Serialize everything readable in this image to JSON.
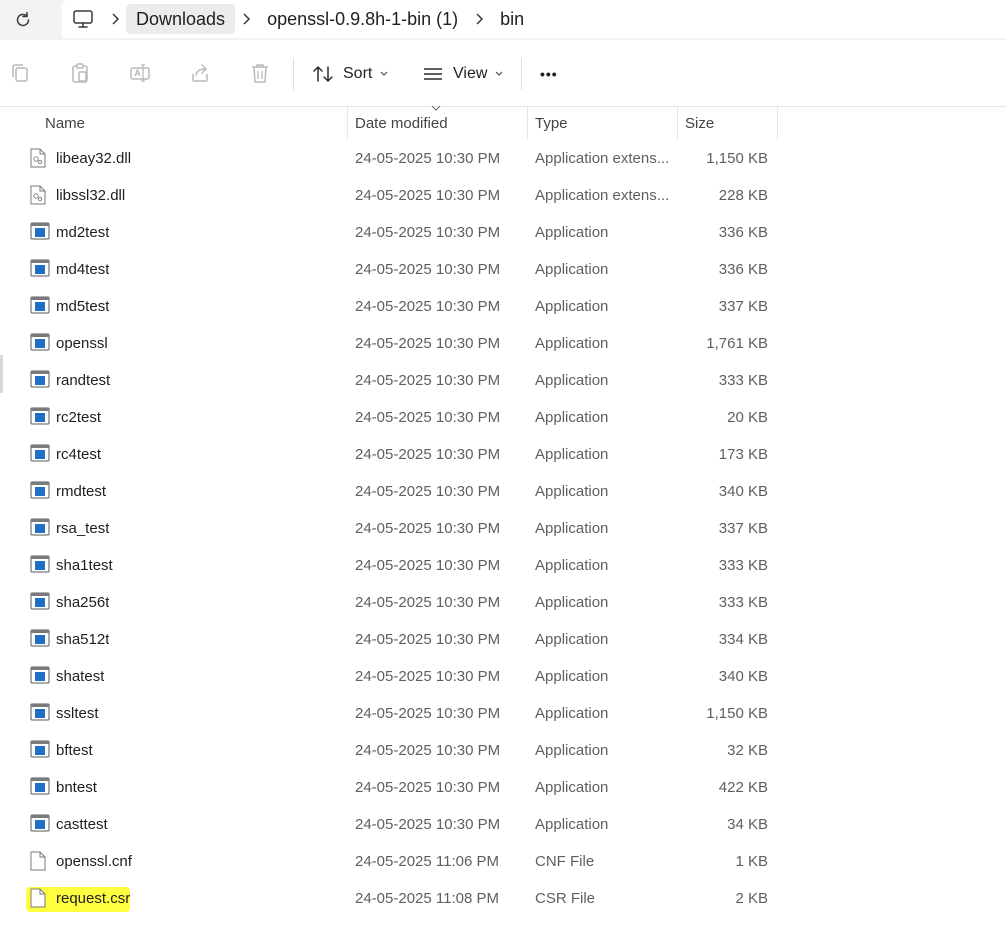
{
  "address": {
    "breadcrumbs": [
      "Downloads",
      "openssl-0.9.8h-1-bin (1)",
      "bin"
    ]
  },
  "toolbar": {
    "sort_label": "Sort",
    "view_label": "View",
    "more_label": "•••"
  },
  "columns": {
    "name": "Name",
    "date": "Date modified",
    "type": "Type",
    "size": "Size"
  },
  "files": [
    {
      "name": "libeay32.dll",
      "date": "24-05-2025 10:30 PM",
      "type": "Application extens...",
      "size": "1,150 KB",
      "icon": "dll-file-icon"
    },
    {
      "name": "libssl32.dll",
      "date": "24-05-2025 10:30 PM",
      "type": "Application extens...",
      "size": "228 KB",
      "icon": "dll-file-icon"
    },
    {
      "name": "md2test",
      "date": "24-05-2025 10:30 PM",
      "type": "Application",
      "size": "336 KB",
      "icon": "application-icon"
    },
    {
      "name": "md4test",
      "date": "24-05-2025 10:30 PM",
      "type": "Application",
      "size": "336 KB",
      "icon": "application-icon"
    },
    {
      "name": "md5test",
      "date": "24-05-2025 10:30 PM",
      "type": "Application",
      "size": "337 KB",
      "icon": "application-icon"
    },
    {
      "name": "openssl",
      "date": "24-05-2025 10:30 PM",
      "type": "Application",
      "size": "1,761 KB",
      "icon": "application-icon"
    },
    {
      "name": "randtest",
      "date": "24-05-2025 10:30 PM",
      "type": "Application",
      "size": "333 KB",
      "icon": "application-icon"
    },
    {
      "name": "rc2test",
      "date": "24-05-2025 10:30 PM",
      "type": "Application",
      "size": "20 KB",
      "icon": "application-icon"
    },
    {
      "name": "rc4test",
      "date": "24-05-2025 10:30 PM",
      "type": "Application",
      "size": "173 KB",
      "icon": "application-icon"
    },
    {
      "name": "rmdtest",
      "date": "24-05-2025 10:30 PM",
      "type": "Application",
      "size": "340 KB",
      "icon": "application-icon"
    },
    {
      "name": "rsa_test",
      "date": "24-05-2025 10:30 PM",
      "type": "Application",
      "size": "337 KB",
      "icon": "application-icon"
    },
    {
      "name": "sha1test",
      "date": "24-05-2025 10:30 PM",
      "type": "Application",
      "size": "333 KB",
      "icon": "application-icon"
    },
    {
      "name": "sha256t",
      "date": "24-05-2025 10:30 PM",
      "type": "Application",
      "size": "333 KB",
      "icon": "application-icon"
    },
    {
      "name": "sha512t",
      "date": "24-05-2025 10:30 PM",
      "type": "Application",
      "size": "334 KB",
      "icon": "application-icon"
    },
    {
      "name": "shatest",
      "date": "24-05-2025 10:30 PM",
      "type": "Application",
      "size": "340 KB",
      "icon": "application-icon"
    },
    {
      "name": "ssltest",
      "date": "24-05-2025 10:30 PM",
      "type": "Application",
      "size": "1,150 KB",
      "icon": "application-icon"
    },
    {
      "name": "bftest",
      "date": "24-05-2025 10:30 PM",
      "type": "Application",
      "size": "32 KB",
      "icon": "application-icon"
    },
    {
      "name": "bntest",
      "date": "24-05-2025 10:30 PM",
      "type": "Application",
      "size": "422 KB",
      "icon": "application-icon"
    },
    {
      "name": "casttest",
      "date": "24-05-2025 10:30 PM",
      "type": "Application",
      "size": "34 KB",
      "icon": "application-icon"
    },
    {
      "name": "openssl.cnf",
      "date": "24-05-2025 11:06 PM",
      "type": "CNF File",
      "size": "1 KB",
      "icon": "document-file-icon"
    },
    {
      "name": "request.csr",
      "date": "24-05-2025 11:08 PM",
      "type": "CSR File",
      "size": "2 KB",
      "icon": "document-file-icon",
      "highlighted": true
    }
  ],
  "colors": {
    "highlight": "#ffff40",
    "app_icon_blue": "#1f6fc5"
  }
}
